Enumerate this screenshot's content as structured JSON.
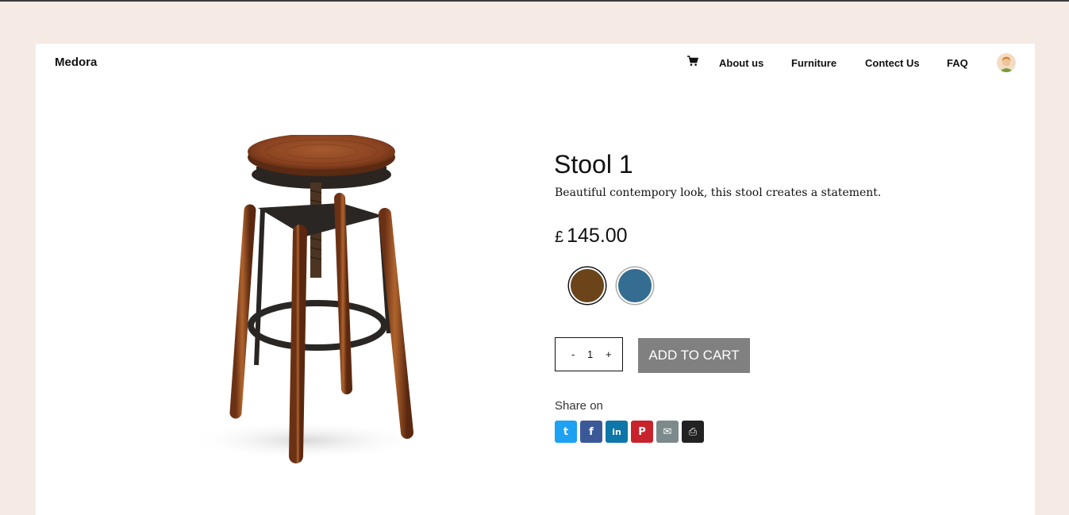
{
  "nav": {
    "brand": "Medora",
    "links": [
      "About us",
      "Furniture",
      "Contect Us",
      "FAQ"
    ],
    "cart_icon": "cart-icon",
    "avatar_icon": "user-avatar"
  },
  "product": {
    "title": "Stool 1",
    "description": "Beautiful contempory look, this stool creates a statement.",
    "price_currency": "£",
    "price_amount": "145.00",
    "colors": [
      {
        "name": "brown",
        "hex": "#6b4419",
        "selected": true
      },
      {
        "name": "blue",
        "hex": "#356c92",
        "selected": false
      }
    ],
    "quantity": {
      "minus": "-",
      "value": "1",
      "plus": "+"
    },
    "add_to_cart": "ADD TO CART"
  },
  "share": {
    "label": "Share on",
    "icons": [
      {
        "name": "twitter-icon",
        "glyph": "t",
        "color": "#1da1f2"
      },
      {
        "name": "facebook-icon",
        "glyph": "f",
        "color": "#3b5998"
      },
      {
        "name": "linkedin-icon",
        "glyph": "in",
        "color": "#0e76a8"
      },
      {
        "name": "pinterest-icon",
        "glyph": "P",
        "color": "#c8232c"
      },
      {
        "name": "email-icon",
        "glyph": "✉",
        "color": "#7c8a8c"
      },
      {
        "name": "print-icon",
        "glyph": "⎙",
        "color": "#222222"
      }
    ]
  },
  "colors": {
    "page_bg": "#f5ebe4",
    "card_bg": "#ffffff",
    "button_bg": "#808080"
  }
}
